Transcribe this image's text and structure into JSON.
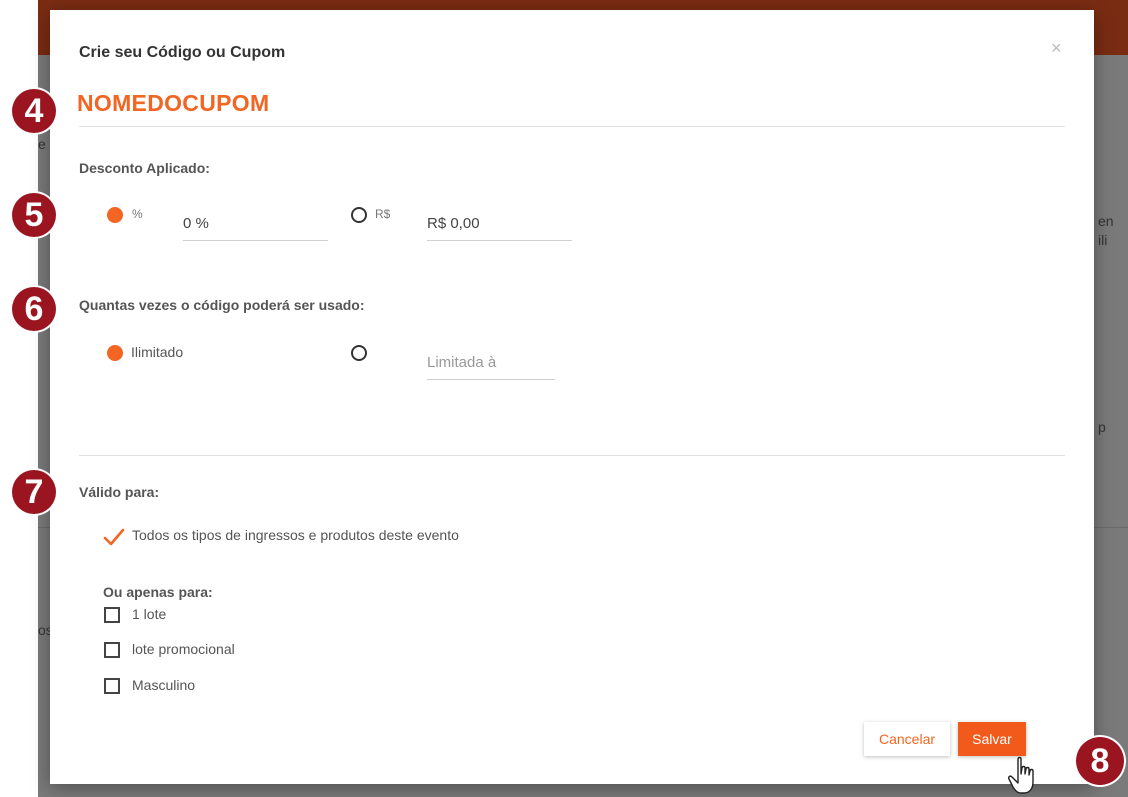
{
  "background": {
    "fragments": [
      "e",
      "en",
      "ili",
      "p",
      "os"
    ]
  },
  "modal": {
    "title": "Crie seu Código ou Cupom",
    "close_glyph": "×",
    "coupon_name": "NOMEDOCUPOM",
    "discount": {
      "label": "Desconto Aplicado:",
      "percent_symbol": "%",
      "percent_value": "0 %",
      "currency_symbol": "R$",
      "currency_value": "R$ 0,00",
      "selected": "percent"
    },
    "usage": {
      "label": "Quantas vezes o código poderá ser usado:",
      "unlimited_label": "Ilimitado",
      "limited_placeholder": "Limitada à",
      "selected": "unlimited"
    },
    "valid_for": {
      "label": "Válido para:",
      "all_label": "Todos os tipos de ingressos e produtos deste evento",
      "all_checked": true,
      "only_for_label": "Ou apenas para:",
      "items": [
        {
          "label": "1 lote",
          "checked": false
        },
        {
          "label": "lote promocional",
          "checked": false
        },
        {
          "label": "Masculino",
          "checked": false
        }
      ]
    },
    "buttons": {
      "cancel": "Cancelar",
      "save": "Salvar"
    }
  },
  "steps": [
    "4",
    "5",
    "6",
    "7",
    "8"
  ],
  "colors": {
    "accent": "#f26522",
    "badge": "#9b1521",
    "topbar": "#7a2c12"
  },
  "icons": {
    "check": "check-icon",
    "cursor": "hand-pointer-icon",
    "close": "close-icon"
  }
}
